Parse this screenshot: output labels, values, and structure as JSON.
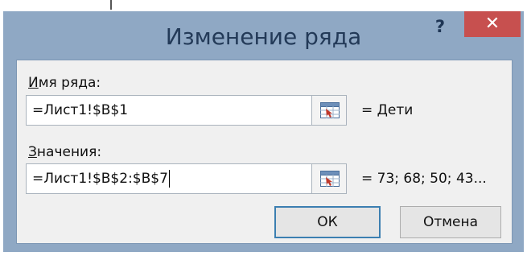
{
  "dialog": {
    "title": "Изменение ряда",
    "help_label": "?",
    "close_label": "✕"
  },
  "name_field": {
    "label_first": "И",
    "label_rest": "мя ряда:",
    "value": "=Лист1!$B$1",
    "preview": "= Дети",
    "ref_icon": "range-select-icon"
  },
  "values_field": {
    "label_first": "З",
    "label_rest": "начения:",
    "value": "=Лист1!$B$2:$B$7",
    "preview": "= 73; 68; 50; 43...",
    "ref_icon": "range-select-icon"
  },
  "buttons": {
    "ok_label": "ОК",
    "cancel_label": "Отмена"
  },
  "colors": {
    "frame": "#8fa8c4",
    "close": "#c7504f",
    "title_text": "#233a58",
    "default_border": "#3c7fb1"
  }
}
